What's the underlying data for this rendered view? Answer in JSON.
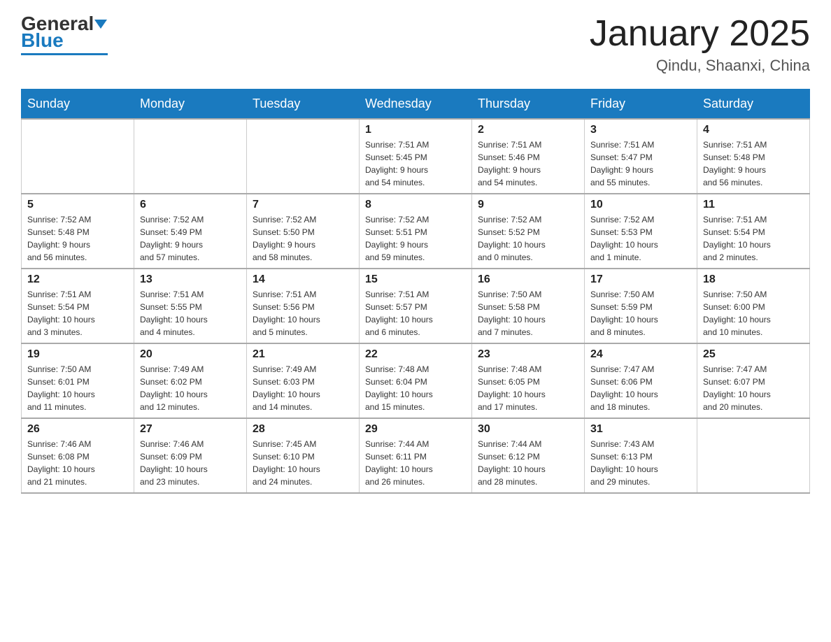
{
  "header": {
    "logo_text_black": "General",
    "logo_text_blue": "Blue",
    "title": "January 2025",
    "subtitle": "Qindu, Shaanxi, China"
  },
  "days_of_week": [
    "Sunday",
    "Monday",
    "Tuesday",
    "Wednesday",
    "Thursday",
    "Friday",
    "Saturday"
  ],
  "weeks": [
    [
      {
        "day": "",
        "info": ""
      },
      {
        "day": "",
        "info": ""
      },
      {
        "day": "",
        "info": ""
      },
      {
        "day": "1",
        "info": "Sunrise: 7:51 AM\nSunset: 5:45 PM\nDaylight: 9 hours\nand 54 minutes."
      },
      {
        "day": "2",
        "info": "Sunrise: 7:51 AM\nSunset: 5:46 PM\nDaylight: 9 hours\nand 54 minutes."
      },
      {
        "day": "3",
        "info": "Sunrise: 7:51 AM\nSunset: 5:47 PM\nDaylight: 9 hours\nand 55 minutes."
      },
      {
        "day": "4",
        "info": "Sunrise: 7:51 AM\nSunset: 5:48 PM\nDaylight: 9 hours\nand 56 minutes."
      }
    ],
    [
      {
        "day": "5",
        "info": "Sunrise: 7:52 AM\nSunset: 5:48 PM\nDaylight: 9 hours\nand 56 minutes."
      },
      {
        "day": "6",
        "info": "Sunrise: 7:52 AM\nSunset: 5:49 PM\nDaylight: 9 hours\nand 57 minutes."
      },
      {
        "day": "7",
        "info": "Sunrise: 7:52 AM\nSunset: 5:50 PM\nDaylight: 9 hours\nand 58 minutes."
      },
      {
        "day": "8",
        "info": "Sunrise: 7:52 AM\nSunset: 5:51 PM\nDaylight: 9 hours\nand 59 minutes."
      },
      {
        "day": "9",
        "info": "Sunrise: 7:52 AM\nSunset: 5:52 PM\nDaylight: 10 hours\nand 0 minutes."
      },
      {
        "day": "10",
        "info": "Sunrise: 7:52 AM\nSunset: 5:53 PM\nDaylight: 10 hours\nand 1 minute."
      },
      {
        "day": "11",
        "info": "Sunrise: 7:51 AM\nSunset: 5:54 PM\nDaylight: 10 hours\nand 2 minutes."
      }
    ],
    [
      {
        "day": "12",
        "info": "Sunrise: 7:51 AM\nSunset: 5:54 PM\nDaylight: 10 hours\nand 3 minutes."
      },
      {
        "day": "13",
        "info": "Sunrise: 7:51 AM\nSunset: 5:55 PM\nDaylight: 10 hours\nand 4 minutes."
      },
      {
        "day": "14",
        "info": "Sunrise: 7:51 AM\nSunset: 5:56 PM\nDaylight: 10 hours\nand 5 minutes."
      },
      {
        "day": "15",
        "info": "Sunrise: 7:51 AM\nSunset: 5:57 PM\nDaylight: 10 hours\nand 6 minutes."
      },
      {
        "day": "16",
        "info": "Sunrise: 7:50 AM\nSunset: 5:58 PM\nDaylight: 10 hours\nand 7 minutes."
      },
      {
        "day": "17",
        "info": "Sunrise: 7:50 AM\nSunset: 5:59 PM\nDaylight: 10 hours\nand 8 minutes."
      },
      {
        "day": "18",
        "info": "Sunrise: 7:50 AM\nSunset: 6:00 PM\nDaylight: 10 hours\nand 10 minutes."
      }
    ],
    [
      {
        "day": "19",
        "info": "Sunrise: 7:50 AM\nSunset: 6:01 PM\nDaylight: 10 hours\nand 11 minutes."
      },
      {
        "day": "20",
        "info": "Sunrise: 7:49 AM\nSunset: 6:02 PM\nDaylight: 10 hours\nand 12 minutes."
      },
      {
        "day": "21",
        "info": "Sunrise: 7:49 AM\nSunset: 6:03 PM\nDaylight: 10 hours\nand 14 minutes."
      },
      {
        "day": "22",
        "info": "Sunrise: 7:48 AM\nSunset: 6:04 PM\nDaylight: 10 hours\nand 15 minutes."
      },
      {
        "day": "23",
        "info": "Sunrise: 7:48 AM\nSunset: 6:05 PM\nDaylight: 10 hours\nand 17 minutes."
      },
      {
        "day": "24",
        "info": "Sunrise: 7:47 AM\nSunset: 6:06 PM\nDaylight: 10 hours\nand 18 minutes."
      },
      {
        "day": "25",
        "info": "Sunrise: 7:47 AM\nSunset: 6:07 PM\nDaylight: 10 hours\nand 20 minutes."
      }
    ],
    [
      {
        "day": "26",
        "info": "Sunrise: 7:46 AM\nSunset: 6:08 PM\nDaylight: 10 hours\nand 21 minutes."
      },
      {
        "day": "27",
        "info": "Sunrise: 7:46 AM\nSunset: 6:09 PM\nDaylight: 10 hours\nand 23 minutes."
      },
      {
        "day": "28",
        "info": "Sunrise: 7:45 AM\nSunset: 6:10 PM\nDaylight: 10 hours\nand 24 minutes."
      },
      {
        "day": "29",
        "info": "Sunrise: 7:44 AM\nSunset: 6:11 PM\nDaylight: 10 hours\nand 26 minutes."
      },
      {
        "day": "30",
        "info": "Sunrise: 7:44 AM\nSunset: 6:12 PM\nDaylight: 10 hours\nand 28 minutes."
      },
      {
        "day": "31",
        "info": "Sunrise: 7:43 AM\nSunset: 6:13 PM\nDaylight: 10 hours\nand 29 minutes."
      },
      {
        "day": "",
        "info": ""
      }
    ]
  ]
}
